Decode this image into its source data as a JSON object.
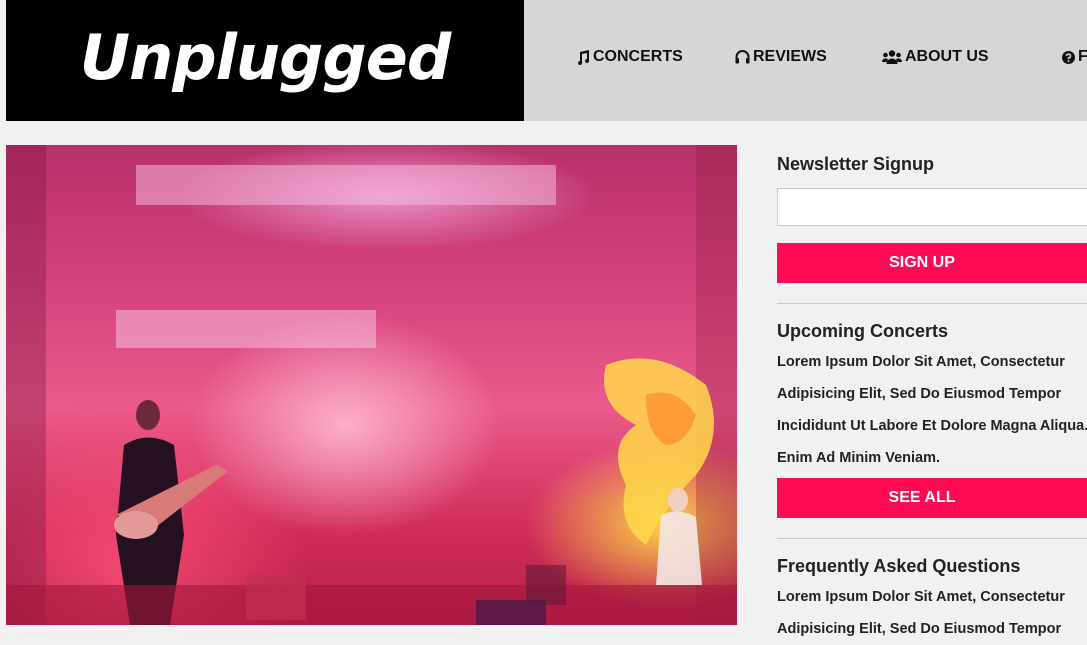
{
  "header": {
    "logo": "Unplugged",
    "nav": [
      {
        "label": "CONCERTS",
        "icon": "music-icon"
      },
      {
        "label": "REVIEWS",
        "icon": "headphones-icon"
      },
      {
        "label": "ABOUT US",
        "icon": "users-icon"
      },
      {
        "label": "FA",
        "icon": "question-circle-icon"
      }
    ]
  },
  "hero": {
    "image": "concert-stage-photo"
  },
  "sidebar": {
    "newsletter": {
      "heading": "Newsletter Signup",
      "input_value": "",
      "button_label": "SIGN UP"
    },
    "upcoming": {
      "heading": "Upcoming Concerts",
      "text": "Lorem Ipsum Dolor Sit Amet, Consectetur Adipisicing Elit, Sed Do Eiusmod Tempor Incididunt Ut Labore Et Dolore Magna Aliqua. Enim Ad Minim Veniam.",
      "button_label": "SEE ALL"
    },
    "faq": {
      "heading": "Frequently Asked Questions",
      "text": "Lorem Ipsum Dolor Sit Amet, Consectetur Adipisicing Elit, Sed Do Eiusmod Tempor"
    }
  },
  "colors": {
    "accent": "#ff0a55",
    "header_bg": "#d6d6d6",
    "logo_bg": "#000000",
    "page_bg": "#f1f1f1"
  }
}
